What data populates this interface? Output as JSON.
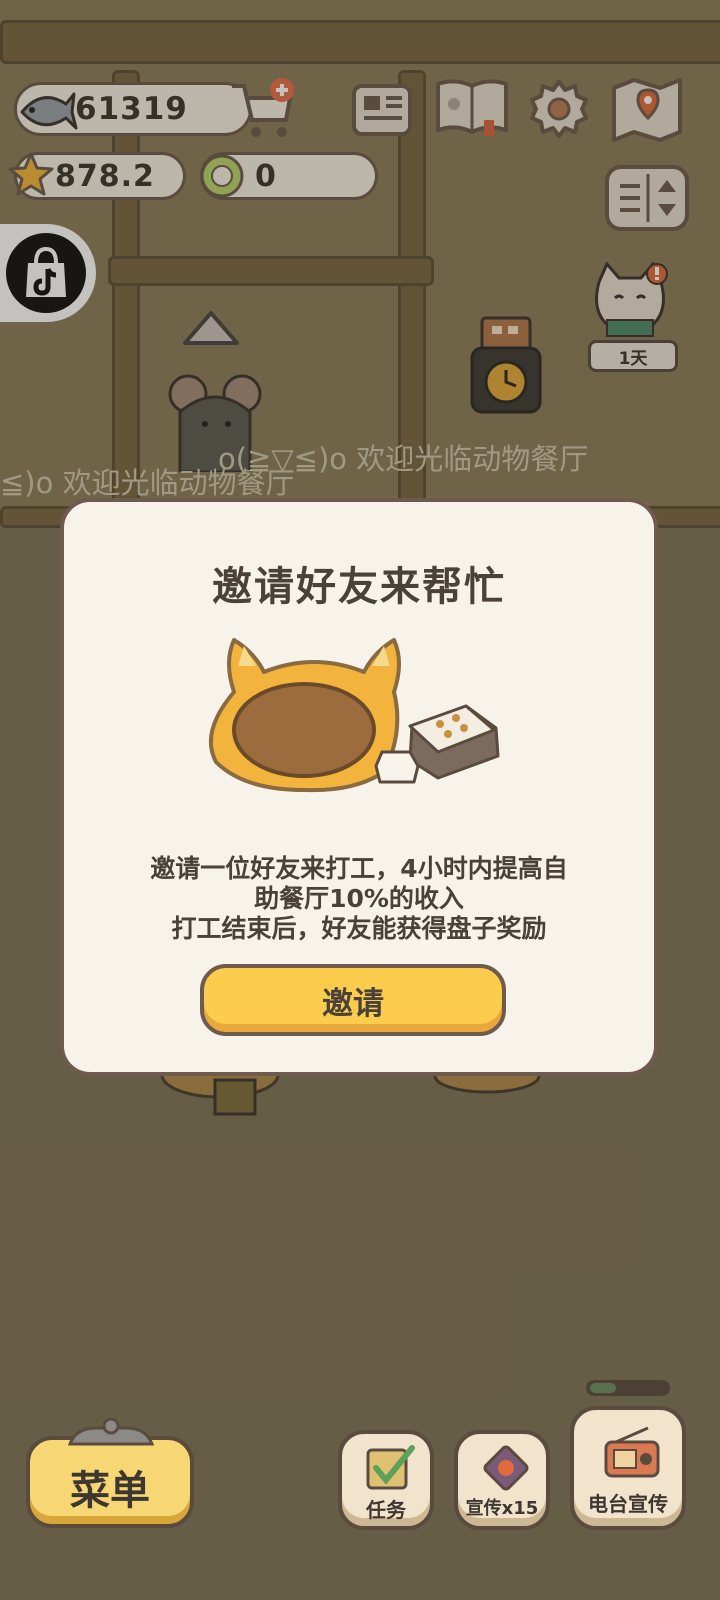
{
  "hud": {
    "fish_count": "61319",
    "star_count": "878.2",
    "plate_count": "0",
    "cat_timer": "1天"
  },
  "marquee": {
    "text_right": "o(≧▽≦)o 欢迎光临动物餐厅",
    "text_left": "≦)o 欢迎光临动物餐厅"
  },
  "modal": {
    "title": "邀请好友来帮忙",
    "desc_lines": [
      "邀请一位好友来打工，4小时内提高自",
      "助餐厅10%的收入",
      "打工结束后，好友能获得盘子奖励"
    ],
    "button_label": "邀请"
  },
  "bottom": {
    "menu_label": "菜单",
    "tasks_label": "任务",
    "promo_label": "宣传x15",
    "radio_label": "电台宣传"
  },
  "colors": {
    "accent": "#fccc4c",
    "panel": "#f8f3ea",
    "outline": "#6f5a4d"
  }
}
